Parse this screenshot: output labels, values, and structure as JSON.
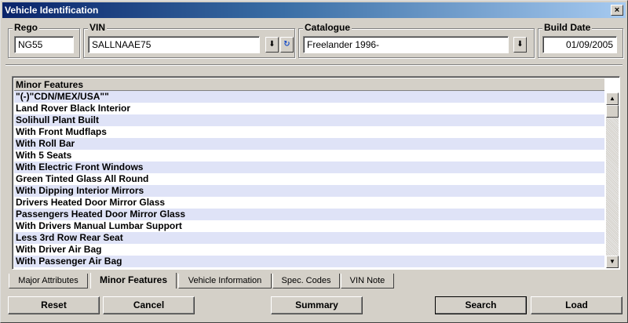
{
  "window": {
    "title": "Vehicle Identification",
    "close_glyph": "×"
  },
  "fields": {
    "rego": {
      "label": "Rego",
      "value": "NG55"
    },
    "vin": {
      "label": "VIN",
      "value": "SALLNAAE75",
      "dropdown_glyph": "⬇",
      "refresh_glyph": "↻"
    },
    "catalogue": {
      "label": "Catalogue",
      "value": "Freelander 1996-",
      "dropdown_glyph": "⬇"
    },
    "build_date": {
      "label": "Build Date",
      "value": "01/09/2005"
    }
  },
  "minor_features": {
    "header": "Minor Features",
    "items": [
      "\"(-)\"CDN/MEX/USA\"\"",
      "Land Rover Black Interior",
      "Solihull Plant Built",
      "With Front Mudflaps",
      "With Roll Bar",
      "With 5 Seats",
      "With Electric Front Windows",
      "Green Tinted Glass All Round",
      "With Dipping Interior Mirrors",
      "Drivers Heated Door Mirror Glass",
      "Passengers Heated Door Mirror Glass",
      "With Drivers Manual Lumbar Support",
      "Less 3rd Row Rear Seat",
      "With Driver Air Bag",
      "With Passenger Air Bag"
    ],
    "scroll_up_glyph": "▲",
    "scroll_down_glyph": "▼"
  },
  "tabs": [
    {
      "label": "Major Attributes",
      "active": false
    },
    {
      "label": "Minor Features",
      "active": true
    },
    {
      "label": "Vehicle Information",
      "active": false
    },
    {
      "label": "Spec. Codes",
      "active": false
    },
    {
      "label": "VIN Note",
      "active": false
    }
  ],
  "buttons": {
    "reset": "Reset",
    "cancel": "Cancel",
    "summary": "Summary",
    "search": "Search",
    "load": "Load"
  }
}
